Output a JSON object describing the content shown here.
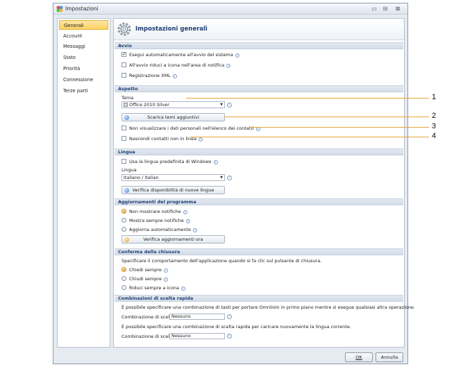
{
  "window": {
    "title": "Impostazioni",
    "controls": [
      "▭",
      "⊟",
      "⊠"
    ]
  },
  "sidebar": {
    "items": [
      {
        "label": "Generali",
        "active": true
      },
      {
        "label": "Account"
      },
      {
        "label": "Messaggi"
      },
      {
        "label": "Stato"
      },
      {
        "label": "Priorità"
      },
      {
        "label": "Connessione"
      },
      {
        "label": "Terze parti"
      }
    ]
  },
  "panel": {
    "title": "Impostazioni generali"
  },
  "avvio": {
    "header": "Avvio",
    "items": [
      {
        "label": "Esegui automaticamente all'avvio del sistema",
        "checked": true
      },
      {
        "label": "All'avvio riduci a icona nell'area di notifica",
        "checked": false
      },
      {
        "label": "Registrazione XML",
        "checked": false
      }
    ]
  },
  "aspetto": {
    "header": "Aspetto",
    "tema_label": "Tema",
    "tema_value": "Office 2010 Silver",
    "download_button": "Scarica temi aggiuntivi",
    "items": [
      {
        "label": "Non visualizzare i dati personali nell'elenco dei contatti",
        "checked": false
      },
      {
        "label": "Nascondi contatti non in linea",
        "checked": false
      }
    ]
  },
  "lingua": {
    "header": "Lingua",
    "use_windows": "Usa la lingua predefinita di Windows",
    "lingua_label": "Lingua",
    "lingua_value": "Italiano / Italian",
    "check_button": "Verifica disponibilità di nuove lingue"
  },
  "aggiornamenti": {
    "header": "Aggiornamenti del programma",
    "options": [
      {
        "label": "Non mostrare notifiche",
        "checked": true
      },
      {
        "label": "Mostra sempre notifiche",
        "checked": false
      },
      {
        "label": "Aggiorna automaticamente",
        "checked": false
      }
    ],
    "check_button": "Verifica aggiornamenti ora"
  },
  "chiusura": {
    "header": "Conferma della chiusura",
    "description": "Specificare il comportamento dell'applicazione quando si fa clic sul pulsante di chiusura.",
    "options": [
      {
        "label": "Chiedi sempre",
        "checked": true
      },
      {
        "label": "Chiudi sempre",
        "checked": false
      },
      {
        "label": "Riduci sempre a icona",
        "checked": false
      }
    ]
  },
  "scelta_rapida": {
    "header": "Combinazioni di scelta rapida",
    "desc1": "È possibile specificare una combinazione di tasti per portare OmniIoin in primo piano mentre si esegue qualsiasi altra operazione.",
    "label1": "Combinazione di scelta",
    "value1": "Nessuno",
    "desc2": "È possibile specificare una combinazione di scelta rapida per caricare nuovamente la lingua corrente.",
    "label2": "Combinazione di scelta",
    "value2": "Nessuno"
  },
  "footer": {
    "ok": "OK",
    "cancel": "Annulla"
  },
  "info_glyph": "i",
  "callouts": [
    "1",
    "2",
    "3",
    "4"
  ],
  "colors": {
    "accent": "#fcd15f",
    "header_text": "#1e3f73",
    "callout": "#e8a437"
  }
}
